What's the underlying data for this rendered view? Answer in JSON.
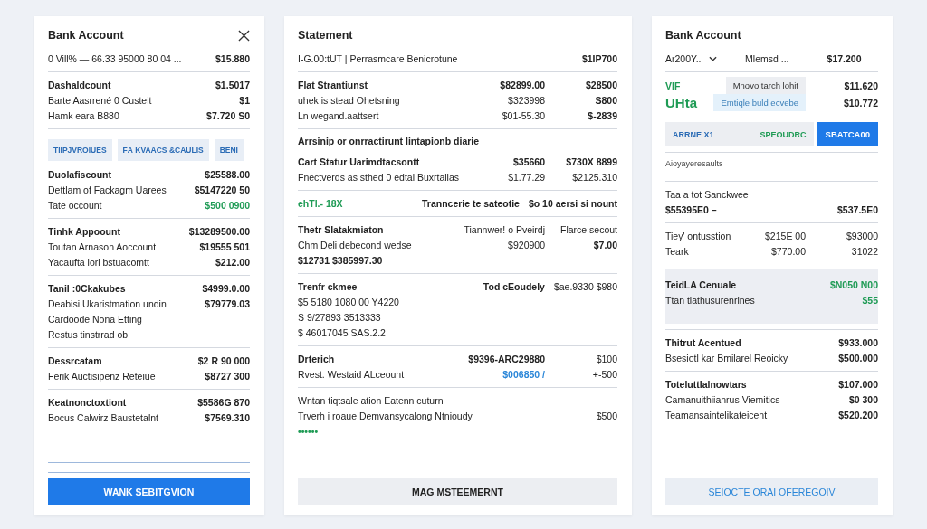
{
  "cards": [
    {
      "title": "Bank Account",
      "closable": true,
      "blocks": [
        {
          "kind": "rows",
          "rows": [
            {
              "cells": [
                {
                  "text": "0  Vill% — 66.33 95000 80 04 ..."
                },
                {
                  "text": "$15.880",
                  "kind": "bold"
                }
              ]
            }
          ]
        },
        {
          "kind": "rows",
          "rows": [
            {
              "cells": [
                {
                  "text": "Dashaldcount",
                  "kind": "bold"
                },
                {
                  "text": "$1.5017",
                  "kind": "bold"
                }
              ]
            },
            {
              "cells": [
                {
                  "text": "Barte Aasrrené 0  Custeit"
                },
                {
                  "text": "$1",
                  "kind": "bold"
                }
              ]
            },
            {
              "cells": [
                {
                  "text": "Hamk eara B880"
                },
                {
                  "text": "$7.720 S0",
                  "kind": "bold"
                }
              ]
            }
          ]
        },
        {
          "kind": "rows",
          "chips": [
            {
              "label": "TIIPJVROIUES",
              "selected": false
            },
            {
              "label": "FÄ KVAACS &CAULIS",
              "selected": false
            },
            {
              "label": "BENI",
              "selected": false
            }
          ],
          "rows": [
            {
              "cells": [
                {
                  "text": "Duolafiscount",
                  "kind": "bold"
                },
                {
                  "text": "$25588.00",
                  "kind": "bold"
                }
              ]
            },
            {
              "cells": [
                {
                  "text": "Dettlam of Fackagm Uarees"
                },
                {
                  "text": "$5147220 50",
                  "kind": "bold"
                }
              ]
            },
            {
              "cells": [
                {
                  "text": "Tate occount"
                },
                {
                  "text": "$500 0900",
                  "kind": "green"
                }
              ]
            }
          ]
        },
        {
          "kind": "rows",
          "rows": [
            {
              "cells": [
                {
                  "text": "Tinhk Appoount",
                  "kind": "bold"
                },
                {
                  "text": "$13289500.00",
                  "kind": "bold"
                }
              ]
            },
            {
              "cells": [
                {
                  "text": "Toutan Arnason Aoccount"
                },
                {
                  "text": "$19555 501",
                  "kind": "bold"
                }
              ]
            },
            {
              "cells": [
                {
                  "text": "Yacaufta lori bstuacomtt"
                },
                {
                  "text": "$212.00",
                  "kind": "bold"
                }
              ]
            }
          ]
        },
        {
          "kind": "rows",
          "rows": [
            {
              "cells": [
                {
                  "text": "Tanil :0Ckakubes",
                  "kind": "bold"
                },
                {
                  "text": "$4999.0.00",
                  "kind": "bold"
                }
              ]
            },
            {
              "cells": [
                {
                  "text": "Deabisi Ukaristmation undin"
                },
                {
                  "text": "$79779.03",
                  "kind": "bold"
                }
              ]
            },
            {
              "cells": [
                {
                  "text": "Cardoode Nona Etting"
                }
              ]
            },
            {
              "cells": [
                {
                  "text": "Restus tinstrrad ob"
                }
              ]
            }
          ]
        },
        {
          "kind": "rows",
          "rows": [
            {
              "cells": [
                {
                  "text": "Dessrcatam",
                  "kind": "bold"
                },
                {
                  "text": "$2 R 90 000",
                  "kind": "bold"
                }
              ]
            },
            {
              "cells": [
                {
                  "text": "Ferik Auctisipenz Reteiue"
                },
                {
                  "text": "$8727 300",
                  "kind": "bold"
                }
              ]
            }
          ]
        },
        {
          "kind": "rows",
          "rows": [
            {
              "cells": [
                {
                  "text": "Keatnonctoxtiont",
                  "kind": "bold"
                },
                {
                  "text": "$5586G 870",
                  "kind": "bold"
                }
              ]
            },
            {
              "cells": [
                {
                  "text": "Bocus Calwirz Baustetalnt"
                },
                {
                  "text": "$7569.310",
                  "kind": "bold"
                }
              ]
            }
          ]
        }
      ],
      "button": {
        "label": "WANK SEBITGVION",
        "kind": "primary"
      }
    },
    {
      "title": "Statement",
      "blocks": [
        {
          "kind": "rows",
          "rows": [
            {
              "cells": [
                {
                  "text": "I-G.00:tUT   |   Perrasmcare Benicrotune"
                },
                {
                  "text": "$1IP700",
                  "kind": "bold"
                }
              ]
            }
          ]
        },
        {
          "kind": "rows",
          "rows": [
            {
              "cells": [
                {
                  "text": "Flat Strantiunst",
                  "kind": "bold"
                },
                {
                  "text": "$82899.00",
                  "kind": "bold"
                },
                {
                  "text": "$28500",
                  "kind": "bold"
                }
              ]
            },
            {
              "cells": [
                {
                  "text": "uhek is stead Ohetsning"
                },
                {
                  "text": "$323998"
                },
                {
                  "text": "S800",
                  "kind": "bold"
                }
              ]
            },
            {
              "cells": [
                {
                  "text": "Ln wegand.aattsert"
                },
                {
                  "text": "$01-55.30"
                },
                {
                  "text": "$-2839",
                  "kind": "bold"
                }
              ]
            }
          ]
        },
        {
          "kind": "rows",
          "caption": {
            "text": "Arrsinip or onrractirunt lintapionb diarie",
            "kind": "bold"
          },
          "rows": [
            {
              "cells": [
                {
                  "text": "Cart Statur Uarimdtacsontt",
                  "kind": "bold"
                },
                {
                  "text": "$35660",
                  "kind": "bold"
                },
                {
                  "text": "$730X 8899",
                  "kind": "bold"
                }
              ]
            },
            {
              "cells": [
                {
                  "text": "Fnectverds as sthed 0 edtai  Buxrtalias"
                },
                {
                  "text": "$1.77.29"
                },
                {
                  "text": "$2125.310"
                }
              ]
            }
          ]
        },
        {
          "kind": "rows",
          "rows": [
            {
              "cells": [
                {
                  "text": "ehTl.- 18X",
                  "kind": "green"
                },
                {
                  "text": "Tranncerie te sateotie",
                  "kind": "bold"
                },
                {
                  "text": "$o 10 aersi si nount",
                  "kind": "bold"
                }
              ]
            }
          ]
        },
        {
          "kind": "rows",
          "rows": [
            {
              "cells": [
                {
                  "text": "Thetr Slatakmiaton",
                  "kind": "bold"
                },
                {
                  "text": "Tiannwer! o Pveirdj"
                },
                {
                  "text": "Flarce secout"
                }
              ]
            },
            {
              "cells": [
                {
                  "text": "Chm Deli debecond wedse"
                },
                {
                  "text": "$920900"
                },
                {
                  "text": "$7.00",
                  "kind": "bold"
                }
              ]
            },
            {
              "cells": [
                {
                  "text": "$12731 $385997.30",
                  "kind": "bold"
                }
              ]
            }
          ]
        },
        {
          "kind": "rows",
          "rows": [
            {
              "cells": [
                {
                  "text": "Trenfr ckmee",
                  "kind": "bold"
                },
                {
                  "text": "Tod cEoudely",
                  "kind": "bold"
                },
                {
                  "text": "$ae.9330   $980"
                }
              ]
            },
            {
              "cells": [
                {
                  "text": "$5 5180 1080 00 Y4220"
                }
              ]
            },
            {
              "cells": [
                {
                  "text": "S 9/27893 3513333"
                }
              ]
            },
            {
              "cells": [
                {
                  "text": "$ 46017045 SAS.2.2"
                }
              ]
            }
          ]
        },
        {
          "kind": "rows",
          "rows": [
            {
              "cells": [
                {
                  "text": "Drterich",
                  "kind": "bold"
                },
                {
                  "text": "$9396-ARC29880",
                  "kind": "bold"
                },
                {
                  "text": "$100"
                }
              ]
            },
            {
              "cells": [
                {
                  "text": "Rvest. Westaid ALceount"
                },
                {
                  "text": "$006850    /",
                  "kind": "blue"
                },
                {
                  "text": "+-500"
                }
              ]
            }
          ]
        },
        {
          "kind": "rows",
          "rows": [
            {
              "cells": [
                {
                  "text": "Wntan tiqtsale ation Eatenn cuturn"
                }
              ]
            },
            {
              "cells": [
                {
                  "text": "Trverh i roaue Demvansycalong Ntnioudy"
                },
                {
                  "text": "$500"
                }
              ]
            },
            {
              "cells": [
                {
                  "text": "••••••",
                  "kind": "green"
                }
              ]
            }
          ]
        }
      ],
      "button": {
        "label": "MAG MSTEEMERNT",
        "kind": "secondary"
      }
    },
    {
      "title": "Bank Account",
      "blocks": [
        {
          "kind": "rows",
          "rows": [
            {
              "cells": [
                {
                  "text": "Ar200Y..",
                  "dropdown": true
                },
                {
                  "text": "Mlemsd ..."
                },
                {
                  "text": "$17.200",
                  "kind": "bold"
                }
              ]
            }
          ]
        },
        {
          "kind": "rows",
          "rows": [
            {
              "cells": [
                {
                  "text": "VIF",
                  "kind": "green"
                },
                {
                  "text": "Mnovo tarch lohit",
                  "kind": "tag"
                },
                {
                  "text": "$11.620",
                  "kind": "bold"
                }
              ]
            },
            {
              "cells": [
                {
                  "text": "UHta",
                  "kind": "large"
                },
                {
                  "text": "Emtiqle buld ecvebe",
                  "kind": "link"
                },
                {
                  "text": "$10.772",
                  "kind": "bold"
                }
              ]
            }
          ]
        },
        {
          "kind": "search",
          "left": "ARRNE X1",
          "right": "SPEOUDRC",
          "action": "SBATCA00"
        },
        {
          "kind": "rows",
          "caption": {
            "text": "Aioyayeresaults",
            "kind": "small"
          }
        },
        {
          "kind": "rows",
          "rows": [
            {
              "cells": [
                {
                  "text": "Taa a tot Sanckwee"
                }
              ]
            },
            {
              "cells": [
                {
                  "text": "$55395E0   –",
                  "kind": "bold"
                },
                {
                  "text": "$537.5E0",
                  "kind": "bold"
                }
              ]
            }
          ]
        },
        {
          "kind": "rows",
          "rows": [
            {
              "cells": [
                {
                  "text": "Tiey' ontusstion"
                },
                {
                  "text": "$215E 00"
                },
                {
                  "text": "$93000"
                }
              ]
            },
            {
              "cells": [
                {
                  "text": "Teark"
                },
                {
                  "text": "$770.00"
                },
                {
                  "text": "31022"
                }
              ]
            }
          ]
        },
        {
          "kind": "panel",
          "rows": [
            {
              "cells": [
                {
                  "text": "TeidLA Cenuale",
                  "kind": "bold"
                },
                {
                  "text": "$N050 N00",
                  "kind": "green"
                }
              ]
            },
            {
              "cells": [
                {
                  "text": "Ttan tlathusurenrines"
                },
                {
                  "text": "$55",
                  "kind": "green"
                }
              ]
            }
          ]
        },
        {
          "kind": "rows",
          "rows": [
            {
              "cells": [
                {
                  "text": "Thitrut Acentued",
                  "kind": "bold"
                },
                {
                  "text": "$933.000",
                  "kind": "bold"
                }
              ]
            },
            {
              "cells": [
                {
                  "text": "Bsesiotl kar Bmilarel Reoicky"
                },
                {
                  "text": "$500.000",
                  "kind": "bold"
                }
              ]
            }
          ]
        },
        {
          "kind": "rows",
          "rows": [
            {
              "cells": [
                {
                  "text": "Toteluttlalnowtars",
                  "kind": "bold"
                },
                {
                  "text": "$107.000",
                  "kind": "bold"
                }
              ]
            },
            {
              "cells": [
                {
                  "text": "Camanuithiianrus Viemitics"
                },
                {
                  "text": "$0 300",
                  "kind": "bold"
                }
              ]
            },
            {
              "cells": [
                {
                  "text": "Teamansaintelikateicent"
                },
                {
                  "text": "$520.200",
                  "kind": "bold"
                }
              ]
            }
          ]
        }
      ],
      "button": {
        "label": "SEIOCTE ORAI OFEREGOIV",
        "kind": "tinted"
      }
    }
  ]
}
